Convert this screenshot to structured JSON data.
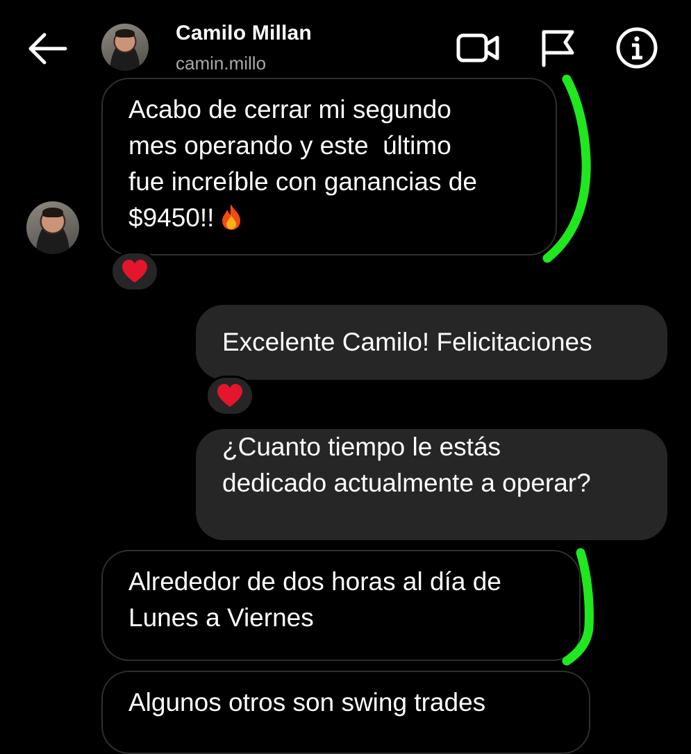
{
  "header": {
    "contact_name": "Camilo Millan",
    "contact_handle": "camin.millo",
    "back_icon": "arrow-left-icon",
    "video_icon": "video-camera-icon",
    "flag_icon": "flag-icon",
    "info_icon": "info-icon"
  },
  "messages": [
    {
      "direction": "incoming",
      "text": "Acabo de cerrar mi segundo\nmes operando y este  último\nfue increíble con ganancias de\n$9450!!",
      "emoji": "fire-icon",
      "reaction": "heart-icon"
    },
    {
      "direction": "outgoing",
      "text": "Excelente Camilo! Felicitaciones",
      "reaction": "heart-icon"
    },
    {
      "direction": "outgoing",
      "text": "¿Cuanto tiempo le estás\ndedicado actualmente a operar?"
    },
    {
      "direction": "incoming",
      "text": "Alrededor de dos horas al día de\nLunes a Viernes"
    },
    {
      "direction": "incoming",
      "text": "Algunos otros son swing trades"
    }
  ],
  "colors": {
    "background": "#000000",
    "bubble_outgoing": "#262626",
    "bubble_incoming_border": "#2f2f2f",
    "handle_text": "#a8a8a8",
    "annotation_stroke": "#1fe81f",
    "heart": "#e5152b"
  }
}
